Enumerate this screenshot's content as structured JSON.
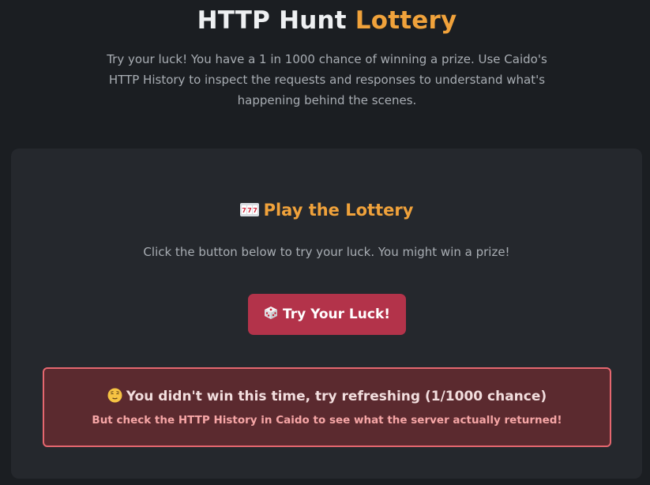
{
  "header": {
    "title_main": "HTTP Hunt",
    "title_accent": "Lottery",
    "intro": "Try your luck! You have a 1 in 1000 chance of winning a prize. Use Caido's HTTP History to inspect the requests and responses to understand what's happening behind the scenes."
  },
  "card": {
    "heading_icon": "slot-machine-icon",
    "heading": "Play the Lottery",
    "text": "Click the button below to try your luck. You might win a prize!",
    "button_icon": "dice-icon",
    "button_label": "Try Your Luck!"
  },
  "result": {
    "icon": "relieved-face-icon",
    "title": "You didn't win this time, try refreshing (1/1000 chance)",
    "subtitle": "But check the HTTP History in Caido to see what the server actually returned!"
  },
  "colors": {
    "background": "#1b1e22",
    "card": "#25282d",
    "accent": "#f0a23b",
    "button": "#b3334a",
    "result_bg": "#5b2a2f",
    "result_border": "#e5676f"
  }
}
